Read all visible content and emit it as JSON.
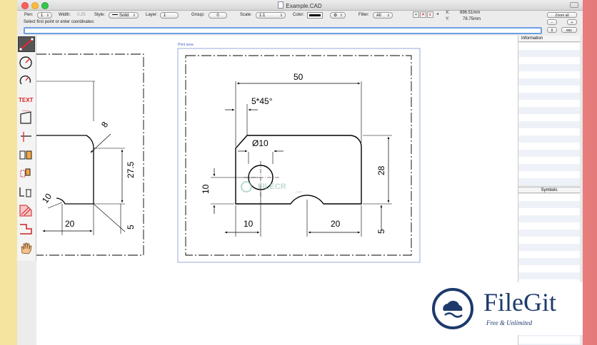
{
  "window": {
    "title": "Example.CAD"
  },
  "toolbar": {
    "pen_label": "Pen:",
    "pen_value": "1",
    "width_label": "Width:",
    "width_value": "0.25",
    "style_label": "Style:",
    "style_value": "Solid",
    "layer_label": "Layer:",
    "layer_value": "1",
    "group_label": "Group:",
    "group_value": "0",
    "scale_label": "Scale:",
    "scale_value": "1:1",
    "color_label": "Color:",
    "color_value": "#000000",
    "filter_label": "Filter:",
    "filter_value": "All",
    "x_label": "X:",
    "x_value": "896.51mm",
    "y_label": "Y:",
    "y_value": "78.75mm",
    "zoom_all": "Zoom all",
    "minus": "−",
    "plus": "+",
    "esc": "esc",
    "prompt": "Select first point or enter coordinates:",
    "command_value": ""
  },
  "canvas": {
    "print_area_label": "Print area",
    "dims": {
      "d50": "50",
      "d5x45": "5*45°",
      "dia10": "Ø10",
      "d28": "28",
      "d10_left": "10",
      "d10_bottom": "10",
      "d20_bottom": "20",
      "d5_right": "5",
      "left_d8": "8",
      "left_d27_5": "27.5",
      "left_d20": "20",
      "left_d5": "5",
      "left_r10": "10"
    },
    "watermark_center": "FILECR",
    "watermark_sub": ".com"
  },
  "panels": {
    "information": "Information",
    "symbols": "Symbols"
  },
  "filegit": {
    "name": "FileGit",
    "tagline": "Free & Unlimited"
  },
  "colors": {
    "accent": "#1d3a6b",
    "print_area": "#4a66cc",
    "focus": "#6aa0e4"
  }
}
